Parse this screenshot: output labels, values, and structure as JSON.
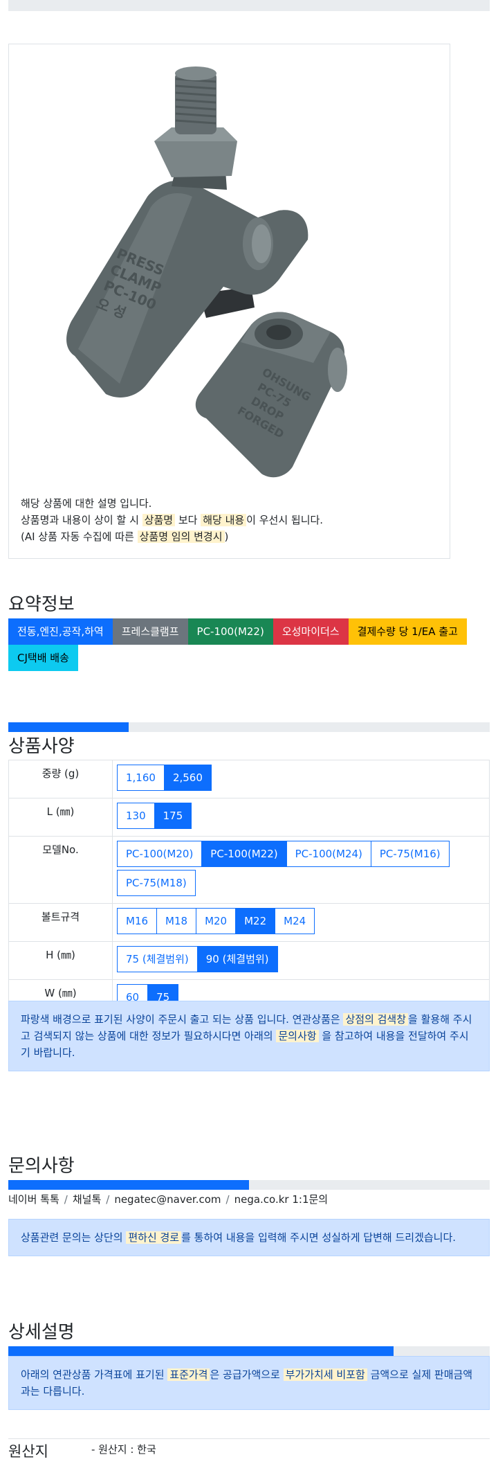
{
  "description": {
    "line1": "해당 상품에 대한 설명 입니다.",
    "line2_a": "상품명과 내용이 상이 할 시 ",
    "line2_hl1": "상품명",
    "line2_b": " 보다 ",
    "line2_hl2": "해당 내용",
    "line2_c": "이 우선시 됩니다.",
    "line3_a": "(AI 상품 자동 수집에 따른 ",
    "line3_hl": "상품명 임의 변경시",
    "line3_b": ")"
  },
  "product_image": {
    "big_clamp_text": [
      "PRESS",
      "CLAMP",
      "PC-100",
      "오  성"
    ],
    "small_clamp_text": [
      "OHSUNG",
      "PC-75",
      "DROP",
      "FORGED"
    ]
  },
  "summary": {
    "title": "요약정보",
    "badges": [
      {
        "label": "전동,엔진,공작,하역",
        "color": "#0d6efd",
        "text": "#ffffff"
      },
      {
        "label": "프레스클램프",
        "color": "#6c757d",
        "text": "#ffffff"
      },
      {
        "label": "PC-100(M22)",
        "color": "#198754",
        "text": "#ffffff"
      },
      {
        "label": "오성마이더스",
        "color": "#dc3545",
        "text": "#ffffff"
      },
      {
        "label": "결제수량 당 1/EA 출고",
        "color": "#ffc107",
        "text": "#000000"
      },
      {
        "label": "CJ택배 배송",
        "color": "#0dcaf0",
        "text": "#000000"
      }
    ]
  },
  "spec": {
    "title": "상품사양",
    "progress": 0.25,
    "rows": [
      {
        "label": "중량 (g)",
        "options": [
          {
            "v": "1,160",
            "sel": false
          },
          {
            "v": "2,560",
            "sel": true
          }
        ]
      },
      {
        "label": "L (㎜)",
        "options": [
          {
            "v": "130",
            "sel": false
          },
          {
            "v": "175",
            "sel": true
          }
        ]
      },
      {
        "label": "모델No.",
        "options": [
          {
            "v": "PC-100(M20)",
            "sel": false
          },
          {
            "v": "PC-100(M22)",
            "sel": true
          },
          {
            "v": "PC-100(M24)",
            "sel": false
          },
          {
            "v": "PC-75(M16)",
            "sel": false
          },
          {
            "v": "PC-75(M18)",
            "sel": false
          }
        ]
      },
      {
        "label": "볼트규격",
        "options": [
          {
            "v": "M16",
            "sel": false
          },
          {
            "v": "M18",
            "sel": false
          },
          {
            "v": "M20",
            "sel": false
          },
          {
            "v": "M22",
            "sel": true
          },
          {
            "v": "M24",
            "sel": false
          }
        ]
      },
      {
        "label": "H (㎜)",
        "options": [
          {
            "v": "75 (체결범위)",
            "sel": false
          },
          {
            "v": "90 (체결범위)",
            "sel": true
          }
        ]
      },
      {
        "label": "W (㎜)",
        "options": [
          {
            "v": "60",
            "sel": false
          },
          {
            "v": "75",
            "sel": true
          }
        ]
      }
    ],
    "notice": {
      "a": "파랑색 배경으로 표기된 사양이 주문시 출고 되는 상품 입니다. 연관상품은 ",
      "hl1": "상점의 검색창",
      "b": "을 활용해 주시고 검색되지 않는 상품에 대한 정보가 필요하시다면 아래의 ",
      "hl2": "문의사항",
      "c": " 을 참고하여 내용을 전달하여 주시기 바랍니다."
    }
  },
  "inquiry": {
    "title": "문의사항",
    "progress": 0.5,
    "contacts": [
      "네이버 톡톡",
      "채널톡",
      "negatec@naver.com",
      "nega.co.kr 1:1문의"
    ],
    "notice": {
      "a": "상품관련 문의는 상단의 ",
      "hl": "편하신 경로",
      "b": "를 통하여 내용을 입력해 주시면 성실하게 답변해 드리겠습니다."
    }
  },
  "detail": {
    "title": "상세설명",
    "progress": 0.8,
    "notice": {
      "a": "아래의 연관상품 가격표에 표기된 ",
      "hl1": "표준가격",
      "b": "은 공급가액으로 ",
      "hl2": "부가가치세 비포함",
      "c": " 금액으로 실제 판매금액과는 다릅니다."
    }
  },
  "origin": {
    "key": "원산지",
    "value": "- 원산지 : 한국"
  }
}
